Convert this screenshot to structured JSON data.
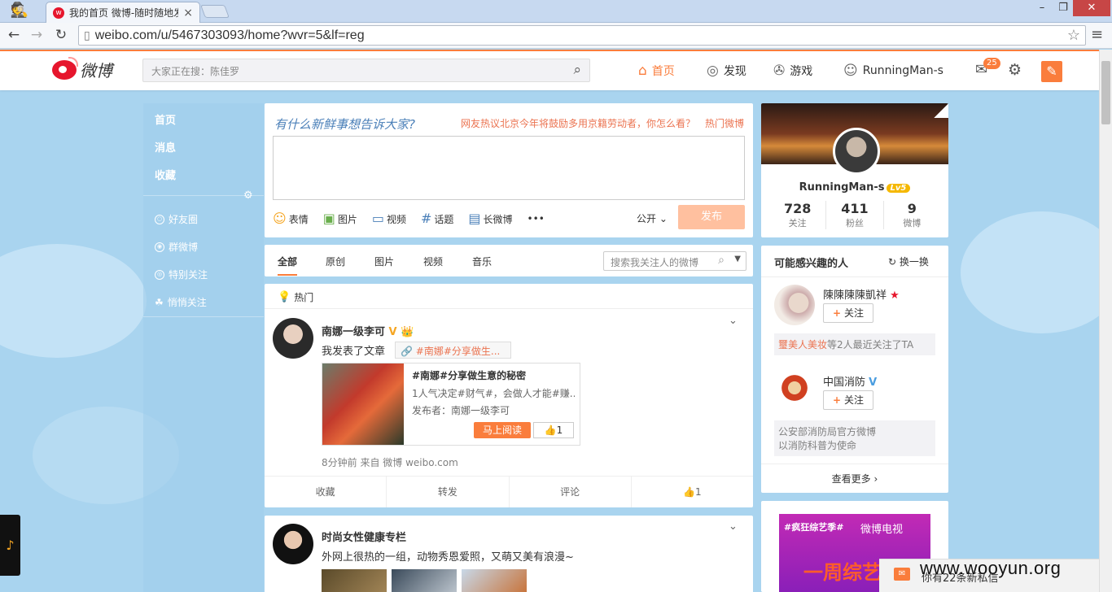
{
  "browser": {
    "tab_title": "我的首页 微博-随时随地发",
    "url": "weibo.com/u/5467303093/home?wvr=5&lf=reg",
    "url_host": "weibo.com",
    "url_path": "/u/5467303093/home?wvr=5&lf=reg"
  },
  "header": {
    "logo_text": "微博",
    "search_placeholder": "大家正在搜：陈佳罗",
    "nav": {
      "home": "首页",
      "discover": "发现",
      "game": "游戏",
      "user": "RunningMan-s"
    },
    "message_badge": "25"
  },
  "left_nav": {
    "main": [
      "首页",
      "消息",
      "收藏"
    ],
    "groups": [
      "好友圈",
      "群微博",
      "特别关注",
      "悄悄关注"
    ]
  },
  "publisher": {
    "prompt": "有什么新鲜事想告诉大家?",
    "hot_topic": "网友热议北京今年将鼓励多用京籍劳动者，你怎么看？",
    "hot_weibo": "热门微博",
    "tools": [
      "表情",
      "图片",
      "视频",
      "话题",
      "长微博"
    ],
    "visibility": "公开",
    "send": "发布"
  },
  "filter": {
    "tabs": [
      "全部",
      "原创",
      "图片",
      "视频",
      "音乐"
    ],
    "search_placeholder": "搜索我关注人的微博"
  },
  "feed": {
    "hot_label": "热门",
    "post1": {
      "author": "南娜一级李可",
      "text": "我发表了文章",
      "topic_link": "#南娜#分享做生...",
      "article_title": "#南娜#分享做生意的秘密",
      "article_desc": "1人气决定#财气#，会做人才能#赚...",
      "article_publisher": "发布者：南娜一级李可",
      "read_btn": "马上阅读",
      "article_likes": "1",
      "meta": "8分钟前 来自 微博 weibo.com",
      "actions": [
        "收藏",
        "转发",
        "评论",
        "1"
      ]
    },
    "post2": {
      "author": "时尚女性健康专栏",
      "text": "外网上很热的一组，动物秀恩爱照，又萌又美有浪漫~"
    }
  },
  "profile": {
    "name": "RunningMan-s",
    "level": "Lv5",
    "stats": [
      {
        "value": "728",
        "label": "关注"
      },
      {
        "value": "411",
        "label": "粉丝"
      },
      {
        "value": "9",
        "label": "微博"
      }
    ]
  },
  "suggestions": {
    "title": "可能感兴趣的人",
    "refresh": "换一换",
    "follow_label": "关注",
    "people": [
      {
        "name": "陳陳陳陳凱祥",
        "reason_hl": "璽美人美妆",
        "reason": "等2人最近关注了TA"
      },
      {
        "name": "中国消防",
        "reason_line1": "公安部消防局官方微博",
        "reason_line2": "以消防科普为使命"
      }
    ],
    "more": "查看更多"
  },
  "ad": {
    "left": "#疯狂综艺季#",
    "right": "微博电视",
    "big": "一周综艺"
  },
  "chat": {
    "text": "你有22条新私信"
  },
  "watermark": "www.wooyun.org",
  "colors": {
    "accent": "#fa7d3c",
    "link": "#eb7350",
    "page_bg": "#a9d4ef"
  }
}
